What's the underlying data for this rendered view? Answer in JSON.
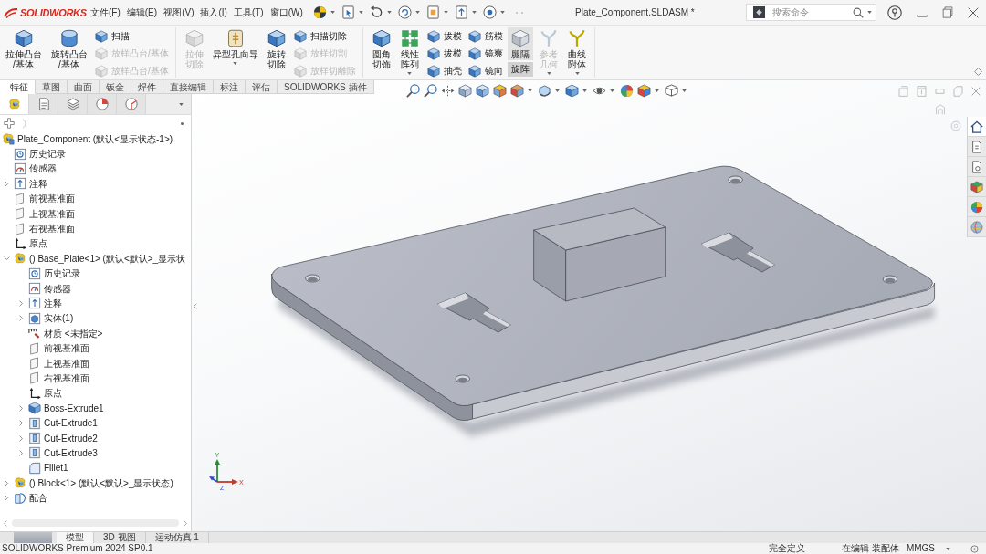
{
  "app": {
    "logo": "SOLIDWORKS",
    "menu": [
      "文件(F)",
      "编辑(E)",
      "视图(V)",
      "插入(I)",
      "工具(T)",
      "窗口(W)"
    ],
    "title": "Plate_Component.SLDASM *",
    "search": {
      "placeholder": "搜索命令"
    }
  },
  "ribbon": {
    "groups": [
      {
        "items": [
          {
            "kind": "large",
            "label": "拉伸凸台/基体",
            "disabled": false,
            "dropdown": false
          },
          {
            "kind": "large",
            "label": "旋转凸台/基体",
            "disabled": false,
            "dropdown": false
          },
          {
            "kind": "stack",
            "items": [
              {
                "label": "扫描",
                "disabled": false
              },
              {
                "label": "放样凸台/基体",
                "disabled": true
              },
              {
                "label": "放样凸台/基体",
                "disabled": true
              }
            ]
          }
        ]
      },
      {
        "items": [
          {
            "kind": "large",
            "label": "拉伸切除",
            "disabled": true,
            "dropdown": false
          },
          {
            "kind": "large",
            "label": "异型孔向导",
            "disabled": false,
            "dropdown": true
          },
          {
            "kind": "large",
            "label": "旋转切除",
            "disabled": false,
            "dropdown": false
          },
          {
            "kind": "stack",
            "items": [
              {
                "label": "扫描切除",
                "disabled": false
              },
              {
                "label": "放样切割",
                "disabled": true
              },
              {
                "label": "放样切離除",
                "disabled": true
              }
            ]
          }
        ]
      },
      {
        "items": [
          {
            "kind": "large",
            "label": "圆角切饰",
            "disabled": false,
            "dropdown": false
          },
          {
            "kind": "large",
            "label": "线性阵列",
            "disabled": false,
            "dropdown": true
          },
          {
            "kind": "stack",
            "items": [
              {
                "label": "拔模",
                "disabled": false
              },
              {
                "label": "拔模",
                "disabled": false
              },
              {
                "label": "抽壳",
                "disabled": false
              }
            ]
          },
          {
            "kind": "stack",
            "items": [
              {
                "label": "筋模",
                "disabled": false
              },
              {
                "label": "镜爽",
                "disabled": false
              },
              {
                "label": "镜向",
                "disabled": false
              }
            ]
          },
          {
            "kind": "toggle",
            "label": "腿隔",
            "sublabel": "旋阵",
            "on": true
          },
          {
            "kind": "large",
            "label": "参考几何",
            "disabled": true,
            "dropdown": true
          },
          {
            "kind": "large",
            "label": "曲线附体",
            "disabled": false,
            "dropdown": true
          }
        ]
      }
    ]
  },
  "command_tabs": [
    {
      "label": "特征",
      "selected": true
    },
    {
      "label": "草图",
      "selected": false
    },
    {
      "label": "曲面",
      "selected": false
    },
    {
      "label": "钣金",
      "selected": false
    },
    {
      "label": "焊件",
      "selected": false
    },
    {
      "label": "直接编辑",
      "selected": false
    },
    {
      "label": "标注",
      "selected": false
    },
    {
      "label": "评估",
      "selected": false
    },
    {
      "label": "SOLIDWORKS 插件",
      "selected": false
    }
  ],
  "feature_manager": {
    "panel_tabs": [
      {
        "selected": true
      },
      {
        "selected": false
      },
      {
        "selected": false
      },
      {
        "selected": false
      },
      {
        "selected": false
      }
    ],
    "tree": {
      "label": "Plate_Component (默认<显示状态-1>)",
      "kind": "assembly",
      "children": [
        {
          "label": "历史记录",
          "kind": "history"
        },
        {
          "label": "传感器",
          "kind": "sensors"
        },
        {
          "label": "注释",
          "kind": "annotations",
          "expanded": false
        },
        {
          "label": "前视基准面",
          "kind": "plane"
        },
        {
          "label": "上视基准面",
          "kind": "plane"
        },
        {
          "label": "右视基准面",
          "kind": "plane"
        },
        {
          "label": "原点",
          "kind": "origin"
        },
        {
          "label": "() Base_Plate<1> (默认<默认>_显示状",
          "kind": "part",
          "expanded": true,
          "children": [
            {
              "label": "历史记录",
              "kind": "history"
            },
            {
              "label": "传感器",
              "kind": "sensors"
            },
            {
              "label": "注释",
              "kind": "annotations",
              "expanded": false
            },
            {
              "label": "实体(1)",
              "kind": "bodies",
              "expanded": false
            },
            {
              "label": "材质 <未指定>",
              "kind": "material"
            },
            {
              "label": "前视基准面",
              "kind": "plane"
            },
            {
              "label": "上视基准面",
              "kind": "plane"
            },
            {
              "label": "右视基准面",
              "kind": "plane"
            },
            {
              "label": "原点",
              "kind": "origin"
            },
            {
              "label": "Boss-Extrude1",
              "kind": "boss",
              "expanded": false
            },
            {
              "label": "Cut-Extrude1",
              "kind": "cut",
              "expanded": false
            },
            {
              "label": "Cut-Extrude2",
              "kind": "cut",
              "expanded": false
            },
            {
              "label": "Cut-Extrude3",
              "kind": "cut",
              "expanded": false
            },
            {
              "label": "Fillet1",
              "kind": "fillet"
            }
          ]
        },
        {
          "label": "() Block<1> (默认<默认>_显示状态)",
          "kind": "part",
          "expanded": false
        },
        {
          "label": "配合",
          "kind": "mates",
          "expanded": false
        }
      ]
    }
  },
  "viewport": {
    "triad_labels": [
      "Y",
      "X",
      "Z"
    ],
    "task_pane": [
      {
        "selected": true
      },
      {
        "selected": false
      },
      {
        "selected": false
      },
      {
        "selected": false
      },
      {
        "selected": false
      },
      {
        "selected": false
      }
    ]
  },
  "bottom_tabs": [
    {
      "label": "模型",
      "selected": true
    },
    {
      "label": "3D 视图",
      "selected": false
    },
    {
      "label": "运动仿真 1",
      "selected": false
    }
  ],
  "status_bar": {
    "product": "SOLIDWORKS Premium 2024 SP0.1",
    "fields": [
      "完全定义",
      "在编辑 装配体",
      "MMGS"
    ]
  }
}
